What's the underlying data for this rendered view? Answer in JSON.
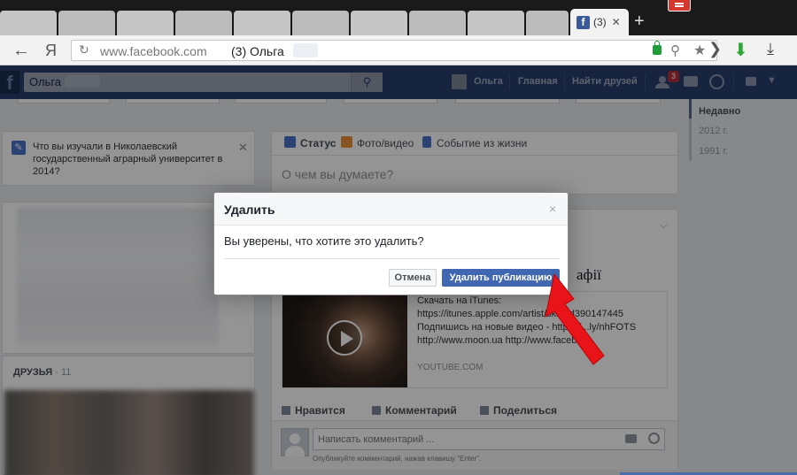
{
  "browser": {
    "tab_title": "(3)",
    "tab_close": "✕",
    "new_tab": "+",
    "url": "www.facebook.com",
    "url_page_title": "(3) Ольга",
    "back_glyph": "←",
    "ya_glyph": "Я"
  },
  "fb_header": {
    "search_value": "Ольга",
    "profile_name": "Ольга",
    "home_link": "Главная",
    "find_friends_link": "Найти друзей",
    "friend_requests_count": "3"
  },
  "left_column": {
    "suggestion_text": "Что вы изучали в Николаевский государственный аграрный университет в 2014?",
    "friends_heading": "ДРУЗЬЯ",
    "friends_count": "· 11"
  },
  "composer": {
    "tab_status": "Статус",
    "tab_photo_video": "Фото/видео",
    "tab_life_event": "Событие из жизни",
    "placeholder": "О чем вы думаете?"
  },
  "post": {
    "title_fragment": "афії",
    "line1": "Скачать на iTunes:",
    "line2": "https://itunes.apple.com/artist/skr...id390147445",
    "line3": "Подпишись на новые видео - https://...ly/nhFOTS",
    "line4": "http://www.moon.ua http://www.faceb...",
    "source": "YOUTUBE.COM",
    "like": "Нравится",
    "comment": "Комментарий",
    "share": "Поделиться",
    "comment_placeholder": "Написать комментарий ...",
    "comment_hint": "Опубликуйте комментарий, нажав клавишу \"Enter\"."
  },
  "timeline": {
    "recent": "Недавно",
    "year1": "2012 г.",
    "year2": "1991 г."
  },
  "modal": {
    "title": "Удалить",
    "close": "×",
    "message": "Вы уверены, что хотите это удалить?",
    "cancel_label": "Отмена",
    "delete_label": "Удалить публикацию"
  },
  "colors": {
    "fb_blue": "#4267b2",
    "fb_header": "#283f6d",
    "annotation_arrow": "#e8141a"
  }
}
